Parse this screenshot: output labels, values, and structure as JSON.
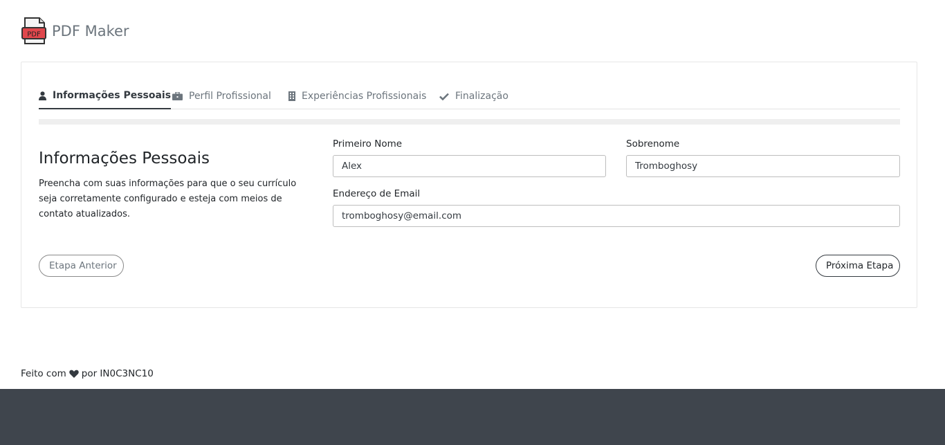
{
  "app": {
    "brand": "PDF Maker",
    "logo_text": "PDF",
    "logo_icon": "pdf-file-icon"
  },
  "tabs": [
    {
      "label": "Informações Pessoais",
      "icon": "user-icon",
      "active": true
    },
    {
      "label": "Perfil Profissional",
      "icon": "briefcase-icon",
      "active": false
    },
    {
      "label": "Experiências Profissionais",
      "icon": "building-icon",
      "active": false
    },
    {
      "label": "Finalização",
      "icon": "check-icon",
      "active": false
    }
  ],
  "progress": 0,
  "section": {
    "title": "Informações Pessoais",
    "description": "Preencha com suas informações para que o seu currículo seja corretamente configurado e esteja com meios de contato atualizados."
  },
  "form": {
    "first_name": {
      "label": "Primeiro Nome",
      "value": "Alex"
    },
    "last_name": {
      "label": "Sobrenome",
      "value": "Tromboghosy"
    },
    "email": {
      "label": "Endereço de Email",
      "value": "tromboghosy@email.com"
    }
  },
  "buttons": {
    "prev": "Etapa Anterior",
    "next": "Próxima Etapa"
  },
  "footer": {
    "made_with": "Feito com",
    "by": "por IN0C3NC10",
    "heart_icon": "heart-icon"
  },
  "colors": {
    "logo_red": "#e0474c",
    "footer_bar": "#3f454d",
    "active_tab": "#343a40"
  }
}
